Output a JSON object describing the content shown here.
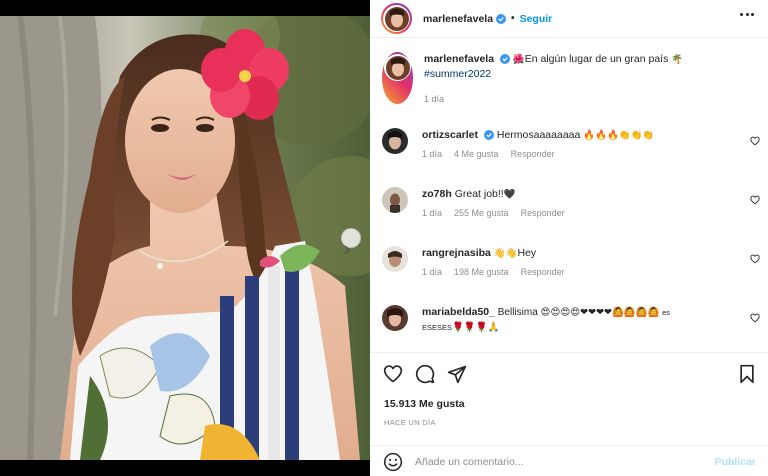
{
  "post": {
    "author": "marlenefavela",
    "follow_label": "Seguir",
    "caption_emoji_start": "🌺",
    "caption_text": "En algún lugar de un gran país",
    "caption_emoji_end": "🌴",
    "hashtag": "#summer2022",
    "caption_time": "1 día",
    "likes": "15.913 Me gusta",
    "time_ago": "HACE UN DÍA"
  },
  "comments": [
    {
      "user": "ortizscarlet",
      "verified": true,
      "text": "Hermosaaaaaaaa",
      "emoji": "🔥🔥🔥👏👏👏",
      "time": "1 día",
      "likes": "4 Me gusta",
      "reply": "Responder"
    },
    {
      "user": "zo78h",
      "verified": false,
      "text": "Great job!!",
      "emoji": "🖤",
      "time": "1 día",
      "likes": "255 Me gusta",
      "reply": "Responder"
    },
    {
      "user": "rangrejnasiba",
      "verified": false,
      "text": "Hey",
      "emoji_before": "👋👋",
      "time": "1 día",
      "likes": "198 Me gusta",
      "reply": "Responder"
    },
    {
      "user": "mariabelda50_",
      "verified": false,
      "text": "Bellisima",
      "emoji": "😍😍😍😍❤❤❤❤🙆🙆🙆🙆",
      "text2": "es",
      "line2_text": "eseses",
      "line2_emoji": "🌹🌹🌹🙏"
    }
  ],
  "composer": {
    "placeholder": "Añade un comentario...",
    "publish_label": "Publicar",
    "emoji_icon": "smiley-icon"
  },
  "icons": {
    "like": "heart-icon",
    "comment": "comment-bubble-icon",
    "share": "paper-plane-icon",
    "save": "bookmark-icon",
    "more": "more-options-icon",
    "next": "chevron-right-icon"
  },
  "colors": {
    "accent": "#0095f6",
    "publish_disabled": "#b2dffc",
    "verified": "#3897f0",
    "hashtag": "#00376b"
  }
}
